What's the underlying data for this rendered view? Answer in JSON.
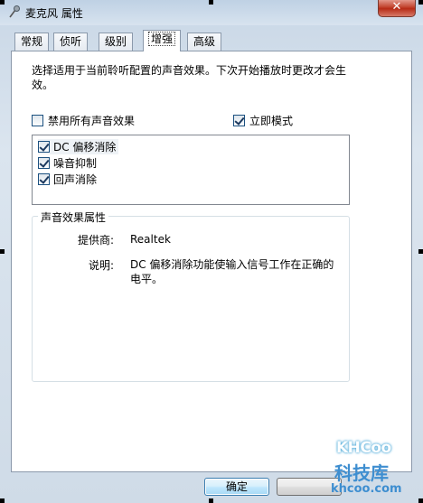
{
  "window": {
    "title": "麦克风 属性",
    "close_label": "✕"
  },
  "tabs": [
    {
      "label": "常规",
      "active": false
    },
    {
      "label": "侦听",
      "active": false
    },
    {
      "label": "级别",
      "active": false
    },
    {
      "label": "增强",
      "active": true
    },
    {
      "label": "高级",
      "active": false
    }
  ],
  "enhancements": {
    "description": "选择适用于当前聆听配置的声音效果。下次开始播放时更改才会生效。",
    "disable_all": {
      "label": "禁用所有声音效果",
      "checked": false
    },
    "immediate_mode": {
      "label": "立即模式",
      "checked": true
    },
    "effects": [
      {
        "label": "DC 偏移消除",
        "checked": true
      },
      {
        "label": "噪音抑制",
        "checked": true
      },
      {
        "label": "回声消除",
        "checked": true
      }
    ]
  },
  "properties": {
    "title": "声音效果属性",
    "provider_label": "提供商:",
    "provider_value": "Realtek",
    "description_label": "说明:",
    "description_value": "DC 偏移消除功能使输入信号工作在正确的电平。"
  },
  "buttons": {
    "ok": "确定",
    "cancel": ""
  },
  "watermark": {
    "logo": "KHCoo",
    "cn": "科技库",
    "url": "khcoo.com"
  },
  "colors": {
    "accent": "#3c7fb1",
    "close": "#c44732"
  }
}
